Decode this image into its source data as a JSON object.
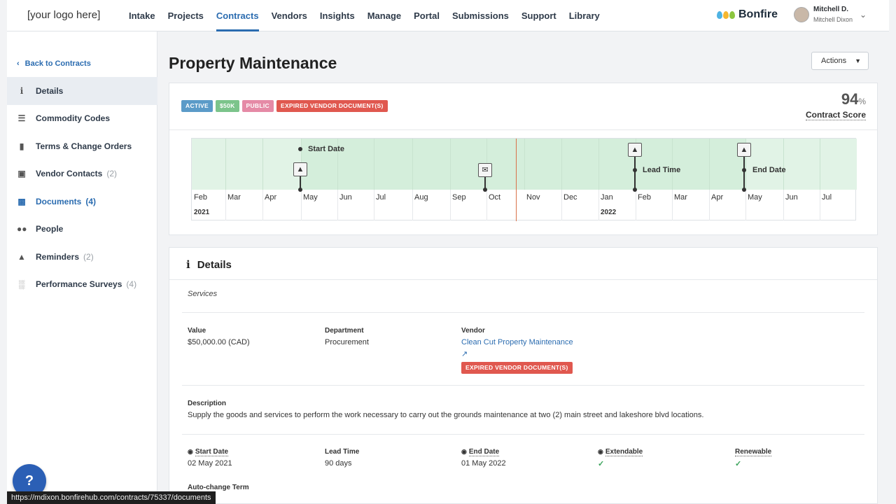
{
  "topbar": {
    "logo": "[your logo here]",
    "nav": [
      "Intake",
      "Projects",
      "Contracts",
      "Vendors",
      "Insights",
      "Manage",
      "Portal",
      "Submissions",
      "Support",
      "Library"
    ],
    "active_nav": "Contracts",
    "brand": "Bonfire",
    "user_short": "Mitchell D.",
    "user_full": "Mitchell Dixon",
    "accent_color": "#2b6cb0"
  },
  "sidebar": {
    "back_label": "Back to Contracts",
    "items": [
      {
        "label": "Details",
        "count": "",
        "icon": "info-icon"
      },
      {
        "label": "Commodity Codes",
        "count": "",
        "icon": "list-icon"
      },
      {
        "label": "Terms & Change Orders",
        "count": "",
        "icon": "folder-icon"
      },
      {
        "label": "Vendor Contacts",
        "count": "(2)",
        "icon": "contact-card-icon"
      },
      {
        "label": "Documents",
        "count": "(4)",
        "icon": "document-icon"
      },
      {
        "label": "People",
        "count": "",
        "icon": "people-icon"
      },
      {
        "label": "Reminders",
        "count": "(2)",
        "icon": "bell-icon"
      },
      {
        "label": "Performance Surveys",
        "count": "(4)",
        "icon": "bar-chart-icon"
      }
    ]
  },
  "help_label": "?",
  "status_url": "https://mdixon.bonfirehub.com/contracts/75337/documents",
  "main": {
    "title": "Property Maintenance",
    "actions_label": "Actions",
    "badges": [
      {
        "label": "ACTIVE",
        "color": "#5b9bc8"
      },
      {
        "label": "$50K",
        "color": "#7cc48b"
      },
      {
        "label": "PUBLIC",
        "color": "#e58aa6"
      },
      {
        "label": "EXPIRED VENDOR DOCUMENT(S)",
        "color": "#e0584f"
      }
    ],
    "score_value": "94",
    "score_unit": "%",
    "score_label": "Contract Score"
  },
  "timeline": {
    "months": [
      "Feb",
      "Mar",
      "Apr",
      "May",
      "Jun",
      "Jul",
      "Aug",
      "Sep",
      "Oct",
      "Nov",
      "Dec",
      "Jan",
      "Feb",
      "Mar",
      "Apr",
      "May",
      "Jun",
      "Jul"
    ],
    "years": [
      "2021",
      "2022"
    ],
    "events": {
      "start": "Start Date",
      "lead": "Lead Time",
      "end": "End Date"
    }
  },
  "details": {
    "title": "Details",
    "category": "Services",
    "value_label": "Value",
    "value": "$50,000.00 (CAD)",
    "department_label": "Department",
    "department": "Procurement",
    "vendor_label": "Vendor",
    "vendor": "Clean Cut Property Maintenance",
    "vendor_badge": "EXPIRED VENDOR DOCUMENT(S)",
    "description_label": "Description",
    "description": "Supply the goods and services to perform the work necessary to carry out the grounds maintenance at two (2) main street and lakeshore blvd locations.",
    "start_label": "Start Date",
    "start": "02 May 2021",
    "lead_label": "Lead Time",
    "lead": "90 days",
    "end_label": "End Date",
    "end": "01 May 2022",
    "extendable_label": "Extendable",
    "renewable_label": "Renewable",
    "autochange_label": "Auto-change Term"
  }
}
